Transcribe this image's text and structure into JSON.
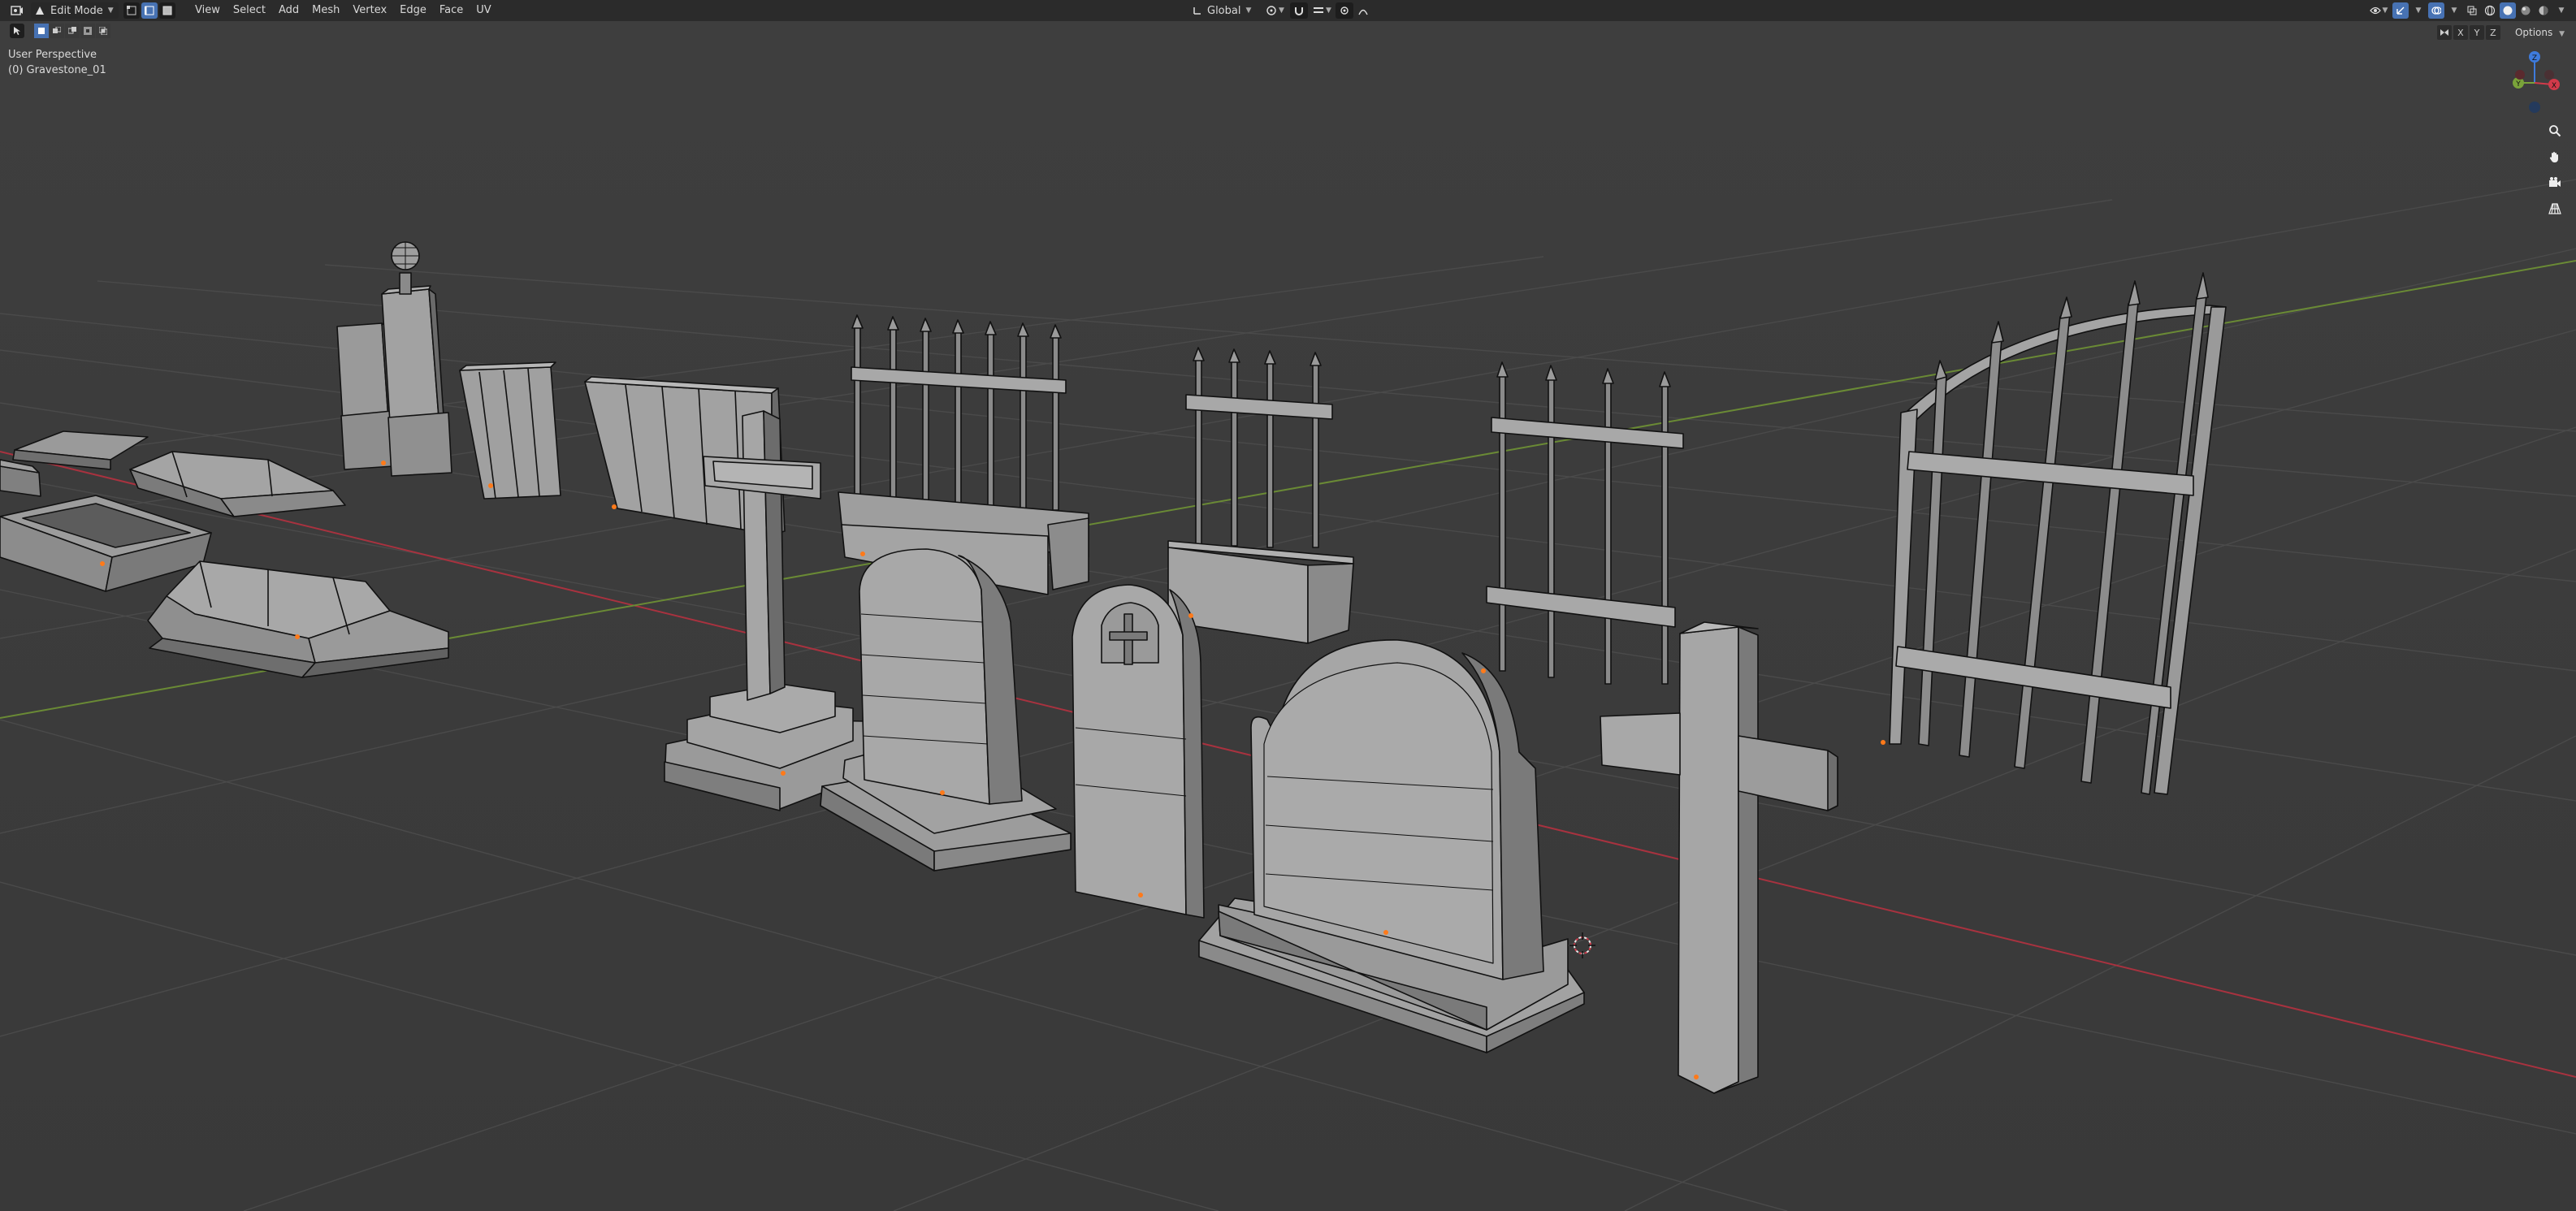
{
  "header": {
    "editor_icon": "editor-type-icon",
    "mode": "Edit Mode",
    "menus": [
      "View",
      "Select",
      "Add",
      "Mesh",
      "Vertex",
      "Edge",
      "Face",
      "UV"
    ],
    "transform_orientation": "Global",
    "options_label": "Options"
  },
  "viewport": {
    "perspective_label": "User Perspective",
    "object_label": "(0) Gravestone_01"
  },
  "axes": {
    "x": "X",
    "y": "Y",
    "z": "Z"
  },
  "colors": {
    "header_bg": "#2b2b2b",
    "viewport_bg": "#3d3d3d",
    "accent_blue": "#4772b3",
    "x_axis": "#d13a4a",
    "y_axis": "#7aa33a",
    "z_axis": "#3e7bdc",
    "mesh_fill": "#8c8c8c",
    "origin_dot": "#ff7a1a"
  }
}
